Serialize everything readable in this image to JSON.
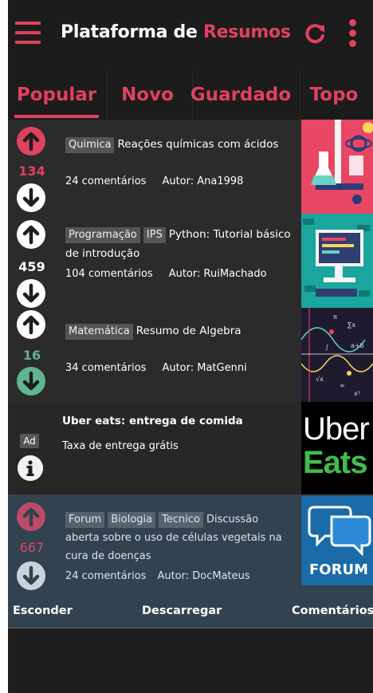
{
  "header": {
    "title_main": "Plataforma de",
    "title_accent": "Resumos",
    "menu_icon": "hamburger-menu-icon",
    "refresh_icon": "refresh-icon",
    "more_icon": "kebab-menu-icon"
  },
  "tabs": [
    {
      "label": "Popular",
      "active": true
    },
    {
      "label": "Novo",
      "active": false
    },
    {
      "label": "Guardado",
      "active": false
    },
    {
      "label": "Topo",
      "active": false
    }
  ],
  "posts": [
    {
      "tags": [
        "Quimica"
      ],
      "title": "Reações químicas com ácidos",
      "score": "134",
      "score_color": "#e0415f",
      "vote_state": "up",
      "comments": "24 comentários",
      "author": "Autor: Ana1998"
    },
    {
      "tags": [
        "Programação",
        "IPS"
      ],
      "title": "Python: Tutorial básico de introdução",
      "score": "459",
      "score_color": "#ffffff",
      "vote_state": "none",
      "comments": "104 comentários",
      "author": "Autor: RuiMachado"
    },
    {
      "tags": [
        "Matemática"
      ],
      "title": "Resumo de Algebra",
      "score": "16",
      "score_color": "#5fb58f",
      "vote_state": "down",
      "comments": "34 comentários",
      "author": "Autor: MatGenni"
    }
  ],
  "ad": {
    "badge": "Ad",
    "title": "Uber eats: entrega de comida",
    "subtitle": "Taxa de entrega grátis",
    "logo_line1": "Uber",
    "logo_line2": "Eats",
    "info_icon": "info-icon"
  },
  "expanded_post": {
    "tags": [
      "Forum",
      "Biologia",
      "Tecnico"
    ],
    "title": "Discussão aberta sobre o uso de células vegetais na cura de doenças",
    "score": "667",
    "score_color": "#d9476c",
    "comments": "24 comentários",
    "author": "Autor: DocMateus",
    "thumb_label": "FORUM",
    "actions": [
      "Esconder",
      "Descarregar",
      "Comentários"
    ]
  },
  "colors": {
    "accent": "#e0415f",
    "background": "#1e1e1e",
    "row": "#2b2b2b",
    "expanded": "#33424f",
    "upvoted": "#e0415f",
    "downvoted": "#5fb58f"
  }
}
